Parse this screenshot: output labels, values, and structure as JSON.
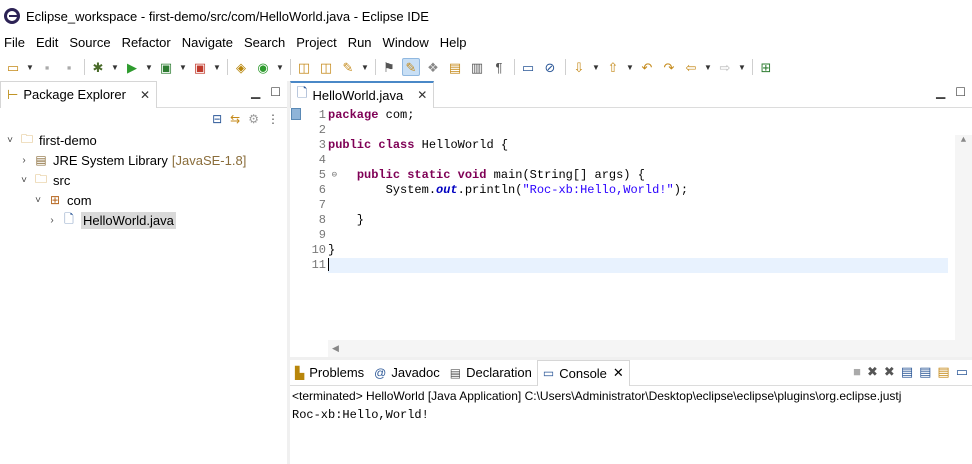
{
  "window": {
    "title": "Eclipse_workspace - first-demo/src/com/HelloWorld.java - Eclipse IDE"
  },
  "menu": [
    "File",
    "Edit",
    "Source",
    "Refactor",
    "Navigate",
    "Search",
    "Project",
    "Run",
    "Window",
    "Help"
  ],
  "package_explorer": {
    "tab_label": "Package Explorer",
    "tree": [
      {
        "label": "first-demo",
        "arrow": "˅",
        "icon": "project-folder-icon"
      },
      {
        "label": "JRE System Library",
        "decoration": "[JavaSE-1.8]",
        "arrow": "›",
        "icon": "library-icon"
      },
      {
        "label": "src",
        "arrow": "˅",
        "icon": "source-folder-icon"
      },
      {
        "label": "com",
        "arrow": "˅",
        "icon": "package-icon"
      },
      {
        "label": "HelloWorld.java",
        "arrow": "›",
        "icon": "java-file-icon"
      }
    ]
  },
  "editor": {
    "tab_label": "HelloWorld.java",
    "line_numbers": [
      "1",
      "2",
      "3",
      "4",
      "5",
      "6",
      "7",
      "8",
      "9",
      "10",
      "11"
    ],
    "code": {
      "l1_kw": "package",
      "l1_rest": " com;",
      "l3_kw1": "public",
      "l3_kw2": "class",
      "l3_rest": " HelloWorld {",
      "l5_kw1": "public",
      "l5_kw2": "static",
      "l5_kw3": "void",
      "l5_rest": " main(String[] args) {",
      "l6_pre": "        System.",
      "l6_field": "out",
      "l6_mid": ".println(",
      "l6_str": "\"Roc-xb:Hello,World!\"",
      "l6_end": ");",
      "l8": "    }",
      "l10": "}"
    }
  },
  "console": {
    "tabs": [
      "Problems",
      "Javadoc",
      "Declaration",
      "Console"
    ],
    "status": "<terminated> HelloWorld [Java Application] C:\\Users\\Administrator\\Desktop\\eclipse\\eclipse\\plugins\\org.eclipse.justj",
    "output": "Roc-xb:Hello,World!"
  }
}
